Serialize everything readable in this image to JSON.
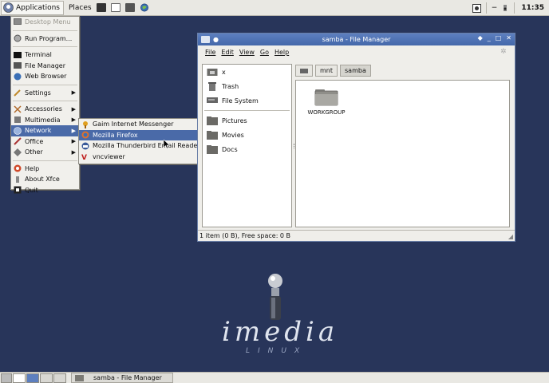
{
  "top_panel": {
    "applications_label": "Applications",
    "places_label": "Places",
    "clock": "11:35"
  },
  "apps_menu": {
    "items": [
      {
        "label": "Desktop Menu",
        "icon": "desktop-icon"
      },
      {
        "label": "Run Program...",
        "icon": "run-icon"
      },
      {
        "label": "Terminal",
        "icon": "terminal-icon"
      },
      {
        "label": "File Manager",
        "icon": "file-manager-icon"
      },
      {
        "label": "Web Browser",
        "icon": "web-browser-icon"
      },
      {
        "label": "Settings",
        "icon": "settings-icon"
      },
      {
        "label": "Accessories",
        "icon": "accessories-icon"
      },
      {
        "label": "Multimedia",
        "icon": "multimedia-icon"
      },
      {
        "label": "Network",
        "icon": "network-icon"
      },
      {
        "label": "Office",
        "icon": "office-icon"
      },
      {
        "label": "Other",
        "icon": "other-icon"
      },
      {
        "label": "Help",
        "icon": "help-icon"
      },
      {
        "label": "About Xfce",
        "icon": "about-icon"
      },
      {
        "label": "Quit",
        "icon": "quit-icon"
      }
    ]
  },
  "network_submenu": {
    "items": [
      {
        "label": "Gaim Internet Messenger",
        "icon": "gaim-icon"
      },
      {
        "label": "Mozilla Firefox",
        "icon": "firefox-icon"
      },
      {
        "label": "Mozilla Thunderbird Email Reader",
        "icon": "thunderbird-icon"
      },
      {
        "label": "vncviewer",
        "icon": "vnc-icon"
      }
    ]
  },
  "file_manager": {
    "title": "samba - File Manager",
    "menu": [
      "File",
      "Edit",
      "View",
      "Go",
      "Help"
    ],
    "side_items": [
      "x",
      "Trash",
      "File System",
      "Pictures",
      "Movies",
      "Docs"
    ],
    "path": [
      "mnt",
      "samba"
    ],
    "files": [
      {
        "name": "WORKGROUP",
        "icon": "folder-icon"
      }
    ],
    "status": "1 item (0 B), Free space: 0 B"
  },
  "desktop": {
    "logo_text": "imedia",
    "logo_sub": "LINUX"
  },
  "taskbar": {
    "task_label": "samba - File Manager"
  },
  "colors": {
    "desktop_bg": "#28355a",
    "selection": "#4a6aa8",
    "titlebar": "#4468aa"
  }
}
